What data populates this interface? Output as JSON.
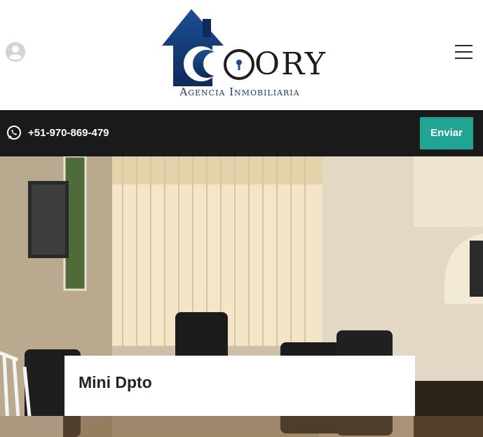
{
  "header": {
    "logo_main": "ORY",
    "logo_sub": "Agencia Inmobiliaria",
    "user_icon": "user-avatar-icon",
    "menu_icon": "hamburger-menu-icon"
  },
  "contact": {
    "phone": "+51-970-869-479",
    "whatsapp_icon": "whatsapp-icon",
    "send_label": "Enviar"
  },
  "listing": {
    "title": "Mini Dpto"
  },
  "colors": {
    "accent": "#20a593",
    "bar": "#1a1a1a",
    "logo_blue": "#143a75"
  }
}
